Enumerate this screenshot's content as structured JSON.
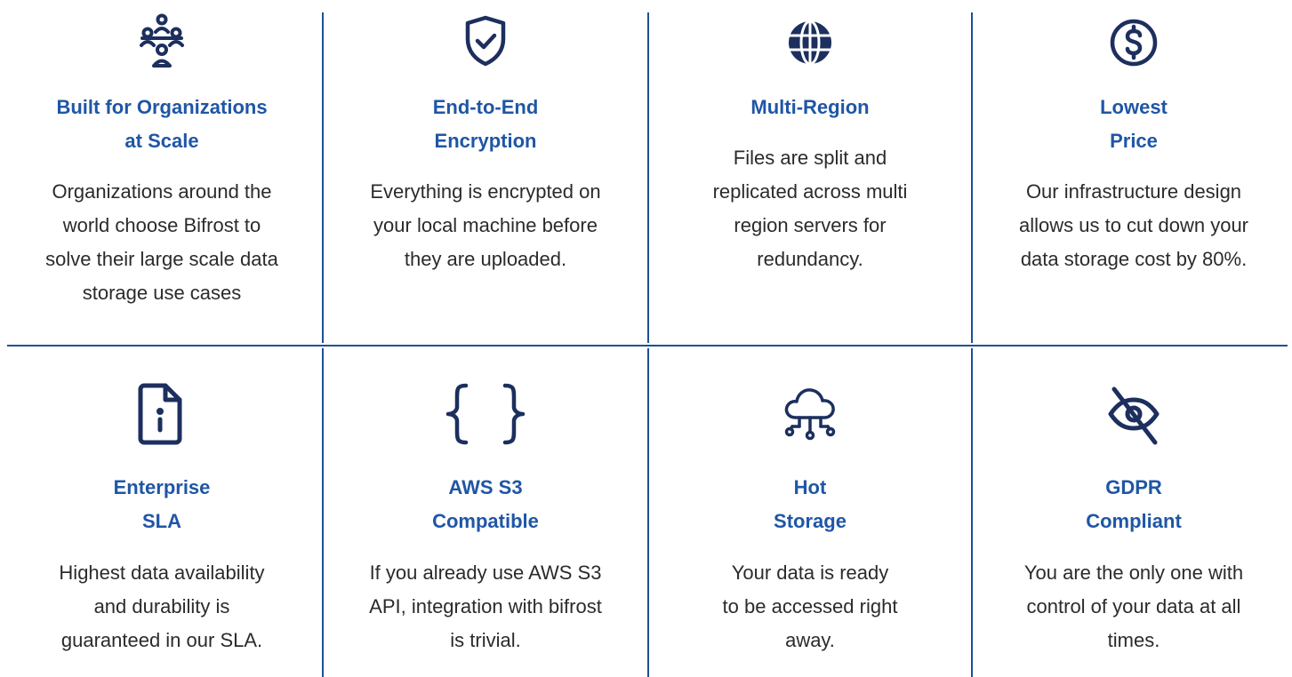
{
  "colors": {
    "title": "#1f56a6",
    "icon": "#1c2f5e",
    "divider": "#1f4f96",
    "text": "#2b2b2b"
  },
  "features": [
    {
      "icon": "organization-icon",
      "title_lines": [
        "Built for Organizations",
        "at Scale"
      ],
      "desc_lines": [
        "Organizations around the",
        "world choose Bifrost to",
        "solve their large scale data",
        "storage use cases"
      ]
    },
    {
      "icon": "shield-check-icon",
      "title_lines": [
        "End-to-End",
        "Encryption"
      ],
      "desc_lines": [
        "Everything is encrypted on",
        "your local machine before",
        "they are uploaded."
      ]
    },
    {
      "icon": "globe-icon",
      "title_lines": [
        "Multi-Region"
      ],
      "desc_lines": [
        "Files are split and",
        "replicated across multi",
        "region servers for",
        "redundancy."
      ]
    },
    {
      "icon": "dollar-icon",
      "title_lines": [
        "Lowest",
        "Price"
      ],
      "desc_lines": [
        "Our infrastructure design",
        "allows us to cut down your",
        "data storage cost by 80%."
      ]
    },
    {
      "icon": "file-info-icon",
      "title_lines": [
        "Enterprise",
        "SLA"
      ],
      "desc_lines": [
        "Highest data availability",
        "and durability is",
        "guaranteed in our SLA."
      ]
    },
    {
      "icon": "curly-braces-icon",
      "title_lines": [
        "AWS S3",
        "Compatible"
      ],
      "desc_lines": [
        "If you already use AWS S3",
        "API, integration with bifrost",
        "is trivial."
      ]
    },
    {
      "icon": "cloud-network-icon",
      "title_lines": [
        "Hot",
        "Storage"
      ],
      "desc_lines": [
        "Your data is ready",
        "to be accessed right",
        "away."
      ]
    },
    {
      "icon": "eye-slash-icon",
      "title_lines": [
        "GDPR",
        "Compliant"
      ],
      "desc_lines": [
        "You are the only one with",
        "control of your data at all",
        "times."
      ]
    }
  ]
}
